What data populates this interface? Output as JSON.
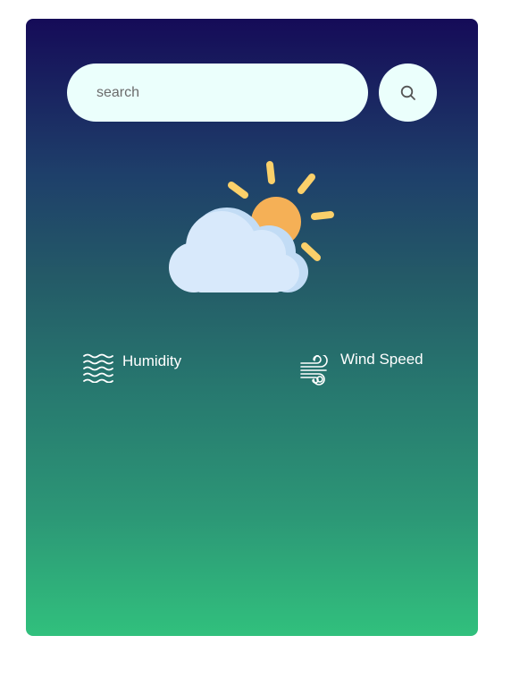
{
  "search": {
    "placeholder": "search",
    "value": ""
  },
  "weather": {
    "icon": "partly-cloudy-icon"
  },
  "details": {
    "humidity": {
      "icon": "humidity-waves-icon",
      "label": "Humidity"
    },
    "wind": {
      "icon": "wind-icon",
      "label": "Wind Speed"
    }
  },
  "colors": {
    "gradient_top": "#150b58",
    "gradient_bottom": "#31c07d",
    "search_background": "#ebfffc",
    "sun": "#f5b056",
    "sun_rays": "#fbd06a",
    "cloud": "#d8e9fb"
  }
}
